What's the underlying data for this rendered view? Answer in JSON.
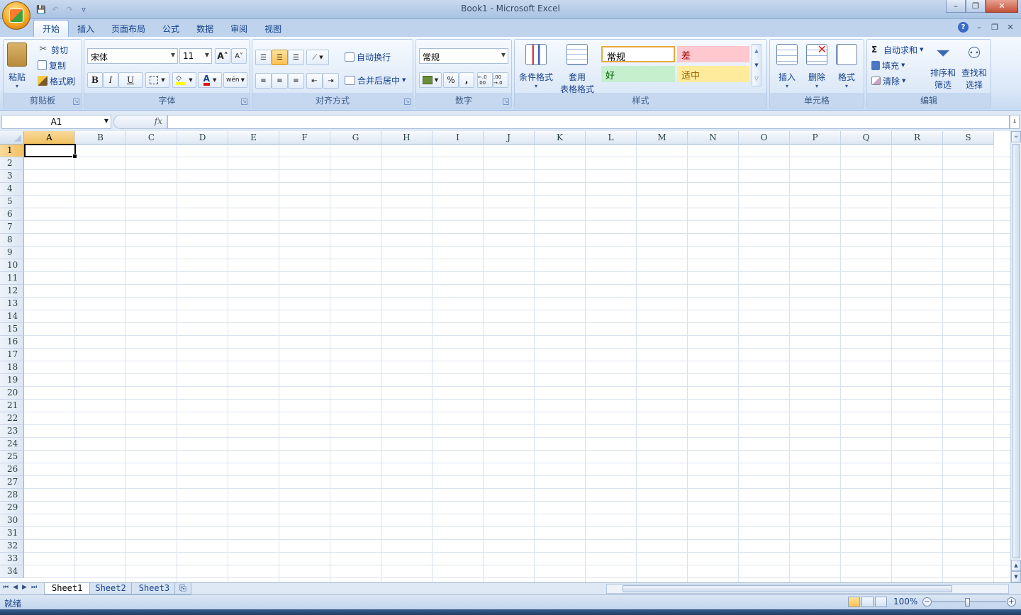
{
  "window": {
    "title": "Book1 - Microsoft Excel",
    "minimize": "–",
    "restore": "❐",
    "close": "✕"
  },
  "qat": {
    "save": "💾",
    "undo": "↶",
    "redo": "↷",
    "customize": "▿"
  },
  "tabs": [
    {
      "label": "开始",
      "active": true
    },
    {
      "label": "插入"
    },
    {
      "label": "页面布局"
    },
    {
      "label": "公式"
    },
    {
      "label": "数据"
    },
    {
      "label": "审阅"
    },
    {
      "label": "视图"
    }
  ],
  "tab_right": {
    "help": "?",
    "min": "–",
    "restore": "❐",
    "close": "✕"
  },
  "clipboard": {
    "label": "剪贴板",
    "paste": "粘贴",
    "cut": "剪切",
    "copy": "复制",
    "format_painter": "格式刷"
  },
  "font": {
    "label": "字体",
    "name": "宋体",
    "size": "11",
    "grow": "A˄",
    "shrink": "A˅",
    "bold": "B",
    "italic": "I",
    "underline": "U",
    "color_letter": "A",
    "phonetic": "wén"
  },
  "alignment": {
    "label": "对齐方式",
    "wrap": "自动换行",
    "merge": "合并后居中"
  },
  "number": {
    "label": "数字",
    "format": "常规",
    "percent": "%",
    "comma": ",",
    "inc_decimal": "←.0 .00",
    "dec_decimal": ".00 →.0"
  },
  "styles": {
    "label": "样式",
    "conditional": "条件格式",
    "table_line1": "套用",
    "table_line2": "表格格式",
    "normal": "常规",
    "bad": "差",
    "good": "好",
    "neutral": "适中"
  },
  "cells_group": {
    "label": "单元格",
    "insert": "插入",
    "delete": "删除",
    "format": "格式"
  },
  "editing": {
    "label": "编辑",
    "autosum": "自动求和",
    "fill": "填充",
    "clear": "清除",
    "sort_line1": "排序和",
    "sort_line2": "筛选",
    "find_line1": "查找和",
    "find_line2": "选择"
  },
  "formula_bar": {
    "name_box": "A1",
    "fx": "fx",
    "value": ""
  },
  "columns": [
    "A",
    "B",
    "C",
    "D",
    "E",
    "F",
    "G",
    "H",
    "I",
    "J",
    "K",
    "L",
    "M",
    "N",
    "O",
    "P",
    "Q",
    "R",
    "S"
  ],
  "rows": [
    "1",
    "2",
    "3",
    "4",
    "5",
    "6",
    "7",
    "8",
    "9",
    "10",
    "11",
    "12",
    "13",
    "14",
    "15",
    "16",
    "17",
    "18",
    "19",
    "20",
    "21",
    "22",
    "23",
    "24",
    "25",
    "26",
    "27",
    "28",
    "29",
    "30",
    "31",
    "32",
    "33",
    "34"
  ],
  "selected_cell": "A1",
  "sheets": [
    {
      "label": "Sheet1",
      "active": true
    },
    {
      "label": "Sheet2"
    },
    {
      "label": "Sheet3"
    }
  ],
  "status": {
    "text": "就绪",
    "zoom": "100%"
  }
}
